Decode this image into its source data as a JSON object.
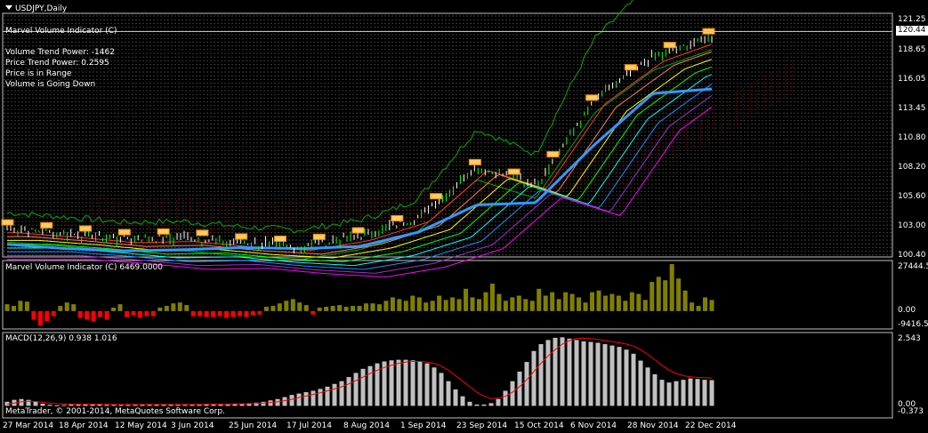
{
  "window": {
    "title": "USDJPY,Daily"
  },
  "main_panel": {
    "indicator_name": "Marvel Volume Indicator (C)",
    "info_lines": [
      "Volume Trend Power: -1462",
      "Price Trend Power: 0.2595",
      "Price is in Range",
      "Volume is Going Down"
    ],
    "price_axis": [
      "121.25",
      "118.65",
      "116.05",
      "113.45",
      "110.80",
      "108.20",
      "105.60",
      "103.00",
      "100.40"
    ],
    "current_price": "120.44"
  },
  "volume_panel": {
    "label": "Marvel Volume Indicator (C) 6469.0000",
    "axis": [
      "27444.5",
      "0.00",
      "-9416.5"
    ]
  },
  "macd_panel": {
    "label": "MACD(12,26,9) 0.938 1.016",
    "axis": [
      "2.543",
      "0.00",
      "-0.373"
    ]
  },
  "copyright": "MetaTrader, © 2001-2014, MetaQuotes Software Corp.",
  "time_axis": [
    "27 Mar 2014",
    "18 Apr 2014",
    "12 May 2014",
    "3 Jun 2014",
    "25 Jun 2014",
    "17 Jul 2014",
    "8 Aug 2014",
    "1 Sep 2014",
    "23 Sep 2014",
    "15 Oct 2014",
    "6 Nov 2014",
    "28 Nov 2014",
    "22 Dec 2014"
  ],
  "colors": {
    "background": "#000000",
    "grid": "#3a3a3a",
    "bull_candle": "#00ff00",
    "volume_up": "#808000",
    "volume_down": "#ff0000",
    "macd_hist": "#c0c0c0",
    "macd_signal": "#ff0000",
    "trend_line": "#3399ff"
  },
  "chart_data": [
    {
      "type": "line",
      "title": "USDJPY,Daily",
      "x": [
        "27 Mar 2014",
        "18 Apr 2014",
        "12 May 2014",
        "3 Jun 2014",
        "25 Jun 2014",
        "17 Jul 2014",
        "8 Aug 2014",
        "1 Sep 2014",
        "23 Sep 2014",
        "15 Oct 2014",
        "6 Nov 2014",
        "28 Nov 2014",
        "22 Dec 2014"
      ],
      "series": [
        {
          "values": [
            102.8,
            102.4,
            101.9,
            102.0,
            101.5,
            101.2,
            102.1,
            103.8,
            108.5,
            106.8,
            114.6,
            118.5,
            120.4
          ]
        }
      ],
      "ylim": [
        100.4,
        122.2
      ]
    },
    {
      "type": "bar",
      "title": "Marvel Volume Indicator (C) 6469.0000",
      "values": [
        4000,
        3000,
        6000,
        5500,
        -5000,
        -8500,
        -6000,
        -3000,
        3000,
        5000,
        4000,
        -4000,
        -5000,
        -6000,
        -3500,
        -5000,
        2000,
        4000,
        -3500,
        -2500,
        -4000,
        -3000,
        -3000,
        2000,
        3000,
        4500,
        5000,
        3500,
        -3000,
        -3000,
        -3500,
        -3500,
        -3000,
        -4000,
        -3500,
        -3000,
        -3500,
        -2500,
        -2000,
        2500,
        3000,
        4500,
        6000,
        7000,
        5000,
        3500,
        -2000,
        2000,
        2500,
        3000,
        3500,
        2500,
        3000,
        3000,
        4500,
        4500,
        4000,
        6000,
        8000,
        7000,
        6000,
        9000,
        8000,
        5000,
        6000,
        9000,
        6500,
        8000,
        7000,
        13000,
        8000,
        7000,
        11000,
        16000,
        10000,
        6000,
        8000,
        9000,
        7000,
        6000,
        13000,
        9000,
        11000,
        7000,
        11000,
        10000,
        8000,
        5000,
        11000,
        12000,
        9000,
        10000,
        9000,
        6000,
        11000,
        10000,
        6500,
        17000,
        20000,
        18000,
        27444.5,
        19000,
        12000,
        5000,
        3000,
        8000,
        6469
      ],
      "ylim": [
        -9416.5,
        27444.5
      ]
    },
    {
      "type": "bar",
      "title": "MACD(12,26,9) 0.938 1.016",
      "values": [
        0.15,
        0.22,
        0.25,
        0.22,
        0.15,
        0.08,
        0.04,
        0.02,
        0.03,
        0.05,
        0.06,
        0.07,
        0.06,
        0.05,
        0.04,
        0.04,
        0.03,
        0.03,
        0.04,
        0.05,
        0.06,
        0.06,
        0.06,
        0.05,
        0.04,
        0.04,
        0.05,
        0.06,
        0.07,
        0.07,
        0.06,
        0.07,
        0.07,
        0.08,
        0.1,
        0.12,
        0.15,
        0.2,
        0.25,
        0.32,
        0.4,
        0.45,
        0.5,
        0.55,
        0.62,
        0.7,
        0.8,
        0.9,
        1.05,
        1.2,
        1.35,
        1.45,
        1.55,
        1.62,
        1.66,
        1.68,
        1.68,
        1.66,
        1.62,
        1.55,
        1.4,
        1.2,
        0.9,
        0.6,
        0.35,
        0.15,
        0.05,
        0.05,
        0.1,
        0.25,
        0.55,
        0.9,
        1.25,
        1.6,
        2.0,
        2.25,
        2.4,
        2.48,
        2.5,
        2.45,
        2.4,
        2.35,
        2.33,
        2.3,
        2.25,
        2.2,
        2.15,
        2.05,
        1.9,
        1.65,
        1.4,
        1.15,
        0.95,
        0.85,
        0.9,
        0.95,
        1.0,
        0.98,
        0.95,
        0.938
      ],
      "signal": [
        0.05,
        0.1,
        0.15,
        0.17,
        0.16,
        0.13,
        0.1,
        0.08,
        0.07,
        0.06,
        0.06,
        0.06,
        0.06,
        0.06,
        0.05,
        0.05,
        0.05,
        0.05,
        0.05,
        0.05,
        0.05,
        0.05,
        0.05,
        0.05,
        0.05,
        0.05,
        0.05,
        0.05,
        0.06,
        0.06,
        0.06,
        0.06,
        0.07,
        0.07,
        0.08,
        0.09,
        0.1,
        0.12,
        0.15,
        0.19,
        0.24,
        0.3,
        0.36,
        0.42,
        0.48,
        0.55,
        0.62,
        0.7,
        0.8,
        0.92,
        1.05,
        1.18,
        1.3,
        1.4,
        1.48,
        1.55,
        1.6,
        1.62,
        1.62,
        1.6,
        1.55,
        1.45,
        1.3,
        1.1,
        0.9,
        0.7,
        0.5,
        0.35,
        0.27,
        0.28,
        0.35,
        0.5,
        0.7,
        0.95,
        1.25,
        1.55,
        1.82,
        2.05,
        2.25,
        2.38,
        2.45,
        2.47,
        2.45,
        2.42,
        2.38,
        2.34,
        2.3,
        2.25,
        2.18,
        2.05,
        1.88,
        1.68,
        1.48,
        1.3,
        1.18,
        1.1,
        1.06,
        1.04,
        1.03,
        1.016
      ],
      "ylim": [
        -0.373,
        2.543
      ]
    }
  ]
}
